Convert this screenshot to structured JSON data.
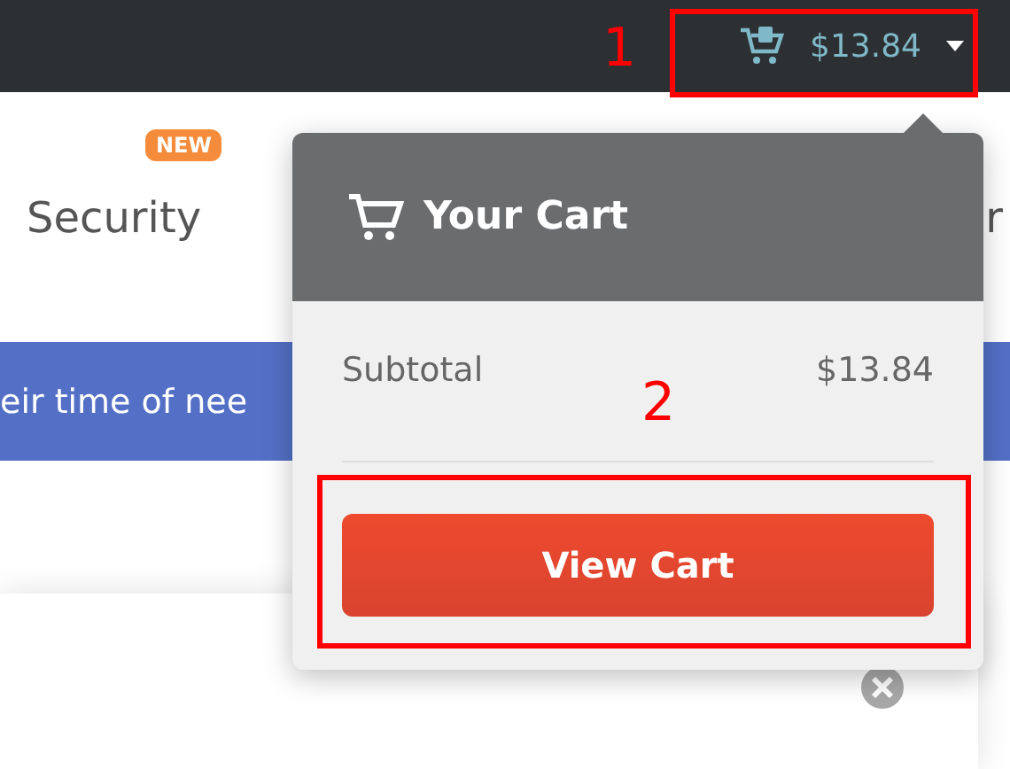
{
  "top_bar": {
    "cart_total": "$13.84"
  },
  "tabs": [
    {
      "label": "Security",
      "badge": "NEW"
    },
    {
      "label": "r"
    }
  ],
  "banner": {
    "text": "eir time of nee"
  },
  "cart_dropdown": {
    "title": "Your Cart",
    "subtotal_label": "Subtotal",
    "subtotal_value": "$13.84",
    "button": "View Cart"
  },
  "annotations": [
    {
      "number": "1"
    },
    {
      "number": "2"
    }
  ]
}
